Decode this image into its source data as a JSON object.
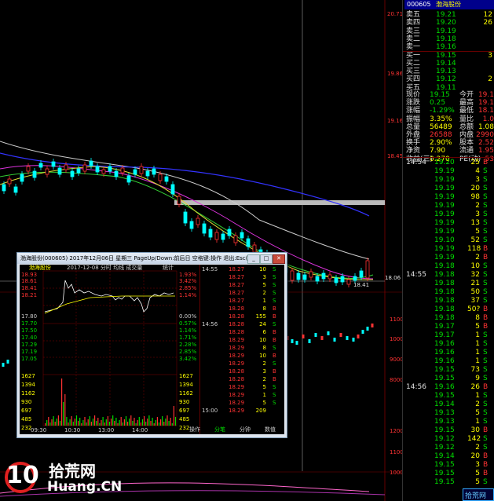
{
  "header": {
    "stock_code": "000605",
    "stock_name": "渤海股份",
    "top_price": "20.71"
  },
  "order_book": [
    {
      "label": "卖五",
      "price": "19.21",
      "vol": "12"
    },
    {
      "label": "卖四",
      "price": "19.20",
      "vol": "26"
    },
    {
      "label": "卖三",
      "price": "19.19",
      "vol": ""
    },
    {
      "label": "卖二",
      "price": "19.18",
      "vol": ""
    },
    {
      "label": "卖一",
      "price": "19.16",
      "vol": ""
    },
    {
      "label": "买一",
      "price": "19.15",
      "vol": "3"
    },
    {
      "label": "买二",
      "price": "19.14",
      "vol": ""
    },
    {
      "label": "买三",
      "price": "19.13",
      "vol": ""
    },
    {
      "label": "买四",
      "price": "19.12",
      "vol": "2"
    },
    {
      "label": "买五",
      "price": "19.11",
      "vol": ""
    }
  ],
  "quote_stats": [
    {
      "l1": "现价",
      "v1": "19.15",
      "l2": "今开",
      "v2": "19.1"
    },
    {
      "l1": "涨跌",
      "v1": "0.25",
      "l2": "最高",
      "v2": "19.1"
    },
    {
      "l1": "涨幅",
      "v1": "-1.29%",
      "l2": "最低",
      "v2": "18.1"
    },
    {
      "l1": "振幅",
      "v1": "3.35%",
      "l2": "量比",
      "v2": "1.0"
    },
    {
      "l1": "总量",
      "v1": "56489",
      "l2": "总额",
      "v2": "1.08"
    },
    {
      "l1": "外盘",
      "v1": "26588",
      "l2": "内盘",
      "v2": "2990"
    },
    {
      "l1": "换手",
      "v1": "2.90%",
      "l2": "股本",
      "v2": "2.52"
    },
    {
      "l1": "净资",
      "v1": "7.90",
      "l2": "流通",
      "v2": "1.95"
    },
    {
      "l1": "收益(三)",
      "v1": "0.270",
      "l2": "PE(动)",
      "v2": "53"
    }
  ],
  "ticks": [
    {
      "t": "14:54",
      "p": "19.20",
      "v": "25",
      "s": "B"
    },
    {
      "t": "",
      "p": "19.19",
      "v": "4",
      "s": "S"
    },
    {
      "t": "",
      "p": "19.19",
      "v": "3",
      "s": "S"
    },
    {
      "t": "",
      "p": "19.19",
      "v": "20",
      "s": "S"
    },
    {
      "t": "",
      "p": "19.19",
      "v": "98",
      "s": "S"
    },
    {
      "t": "",
      "p": "19.19",
      "v": "2",
      "s": "S"
    },
    {
      "t": "",
      "p": "19.19",
      "v": "3",
      "s": "S"
    },
    {
      "t": "",
      "p": "19.19",
      "v": "13",
      "s": "S"
    },
    {
      "t": "",
      "p": "19.19",
      "v": "5",
      "s": "S"
    },
    {
      "t": "",
      "p": "19.10",
      "v": "52",
      "s": "S"
    },
    {
      "t": "",
      "p": "19.19",
      "v": "118",
      "s": "B"
    },
    {
      "t": "",
      "p": "19.19",
      "v": "2",
      "s": "B"
    },
    {
      "t": "",
      "p": "19.18",
      "v": "10",
      "s": "S"
    },
    {
      "t": "14:55",
      "p": "19.18",
      "v": "32",
      "s": "S"
    },
    {
      "t": "",
      "p": "19.18",
      "v": "21",
      "s": "S"
    },
    {
      "t": "",
      "p": "19.18",
      "v": "50",
      "s": "S"
    },
    {
      "t": "",
      "p": "19.18",
      "v": "37",
      "s": "S"
    },
    {
      "t": "",
      "p": "19.18",
      "v": "50?",
      "s": "B"
    },
    {
      "t": "",
      "p": "19.18",
      "v": "8",
      "s": "B"
    },
    {
      "t": "",
      "p": "19.17",
      "v": "5",
      "s": "B"
    },
    {
      "t": "",
      "p": "19.17",
      "v": "1",
      "s": "S"
    },
    {
      "t": "",
      "p": "19.16",
      "v": "1",
      "s": "S"
    },
    {
      "t": "",
      "p": "19.16",
      "v": "1",
      "s": "S"
    },
    {
      "t": "",
      "p": "19.16",
      "v": "1",
      "s": "S"
    },
    {
      "t": "",
      "p": "19.15",
      "v": "73",
      "s": "S"
    },
    {
      "t": "",
      "p": "19.15",
      "v": "9",
      "s": "S"
    },
    {
      "t": "14:56",
      "p": "19.16",
      "v": "26",
      "s": "B"
    },
    {
      "t": "",
      "p": "19.15",
      "v": "1",
      "s": "S"
    },
    {
      "t": "",
      "p": "19.14",
      "v": "2",
      "s": "S"
    },
    {
      "t": "",
      "p": "19.13",
      "v": "5",
      "s": "S"
    },
    {
      "t": "",
      "p": "19.13",
      "v": "1",
      "s": "S"
    },
    {
      "t": "",
      "p": "19.15",
      "v": "30",
      "s": "B"
    },
    {
      "t": "",
      "p": "19.12",
      "v": "142",
      "s": "S"
    },
    {
      "t": "",
      "p": "19.12",
      "v": "2",
      "s": "S"
    },
    {
      "t": "",
      "p": "19.14",
      "v": "20",
      "s": "B"
    },
    {
      "t": "",
      "p": "19.15",
      "v": "3",
      "s": "B"
    },
    {
      "t": "",
      "p": "19.15",
      "v": "5",
      "s": "B"
    },
    {
      "t": "",
      "p": "19.15",
      "v": "5",
      "s": "S"
    }
  ],
  "main_chart": {
    "tick_labels": [
      "19.86",
      "19.16",
      "18.45"
    ],
    "vol_labels": [
      "11000",
      "10000",
      "9000",
      "8000"
    ],
    "bottom_labels": [
      "12000",
      "11000",
      "10000"
    ],
    "annot_low": "18.06",
    "annot_mid": "18.41"
  },
  "popup": {
    "title": "渤海股份(000605)  2017年12月06日 星期三  PageUp/Down:前后日 空格键:操作 退出:Esc(X)",
    "sub_name": "渤海股份",
    "sub_header": "2017-12-08 分时 均线 成交量",
    "stat_label": "统计",
    "price_ticks": [
      "18.93",
      "18.61",
      "18.41",
      "18.21",
      "17.80",
      "17.70",
      "17.50",
      "17.40",
      "17.29",
      "17.19",
      "17.05"
    ],
    "pct_ticks": [
      "1.93%",
      "3.42%",
      "2.85%",
      "1.14%",
      "0.00%",
      "0.57%",
      "1.14%",
      "1.71%",
      "2.28%",
      "2.85%",
      "3.42%"
    ],
    "vol_ticks": [
      "1627",
      "1394",
      "1162",
      "930",
      "697",
      "485",
      "232"
    ],
    "time_ticks": [
      "09:30",
      "10:30",
      "13:00",
      "14:00"
    ],
    "tick_rows": [
      {
        "t": "14:55",
        "p": "18.27",
        "v": "10",
        "s": "S"
      },
      {
        "t": "",
        "p": "18.27",
        "v": "3",
        "s": "S"
      },
      {
        "t": "",
        "p": "18.27",
        "v": "5",
        "s": "S"
      },
      {
        "t": "",
        "p": "18.27",
        "v": "2",
        "s": "S"
      },
      {
        "t": "",
        "p": "18.27",
        "v": "1",
        "s": "S"
      },
      {
        "t": "",
        "p": "18.28",
        "v": "8",
        "s": "B"
      },
      {
        "t": "",
        "p": "18.28",
        "v": "155",
        "s": "B"
      },
      {
        "t": "14:56",
        "p": "18.28",
        "v": "24",
        "s": "S"
      },
      {
        "t": "",
        "p": "18.28",
        "v": "6",
        "s": "B"
      },
      {
        "t": "",
        "p": "18.29",
        "v": "10",
        "s": "B"
      },
      {
        "t": "",
        "p": "18.29",
        "v": "8",
        "s": "S"
      },
      {
        "t": "",
        "p": "18.29",
        "v": "10",
        "s": "B"
      },
      {
        "t": "",
        "p": "18.29",
        "v": "2",
        "s": "S"
      },
      {
        "t": "",
        "p": "18.28",
        "v": "3",
        "s": "B"
      },
      {
        "t": "",
        "p": "18.28",
        "v": "2",
        "s": "B"
      },
      {
        "t": "",
        "p": "18.29",
        "v": "5",
        "s": "S"
      },
      {
        "t": "",
        "p": "18.29",
        "v": "1",
        "s": "S"
      },
      {
        "t": "",
        "p": "18.29",
        "v": "5",
        "s": "S"
      },
      {
        "t": "15:00",
        "p": "18.29",
        "v": "209",
        "s": ""
      }
    ],
    "tabs": [
      "操作",
      "分笔",
      "分钟",
      "数值"
    ]
  },
  "watermark": {
    "number": "10",
    "cn": "拾荒网",
    "en": "Huang.CN",
    "corner": "拾荒网"
  }
}
